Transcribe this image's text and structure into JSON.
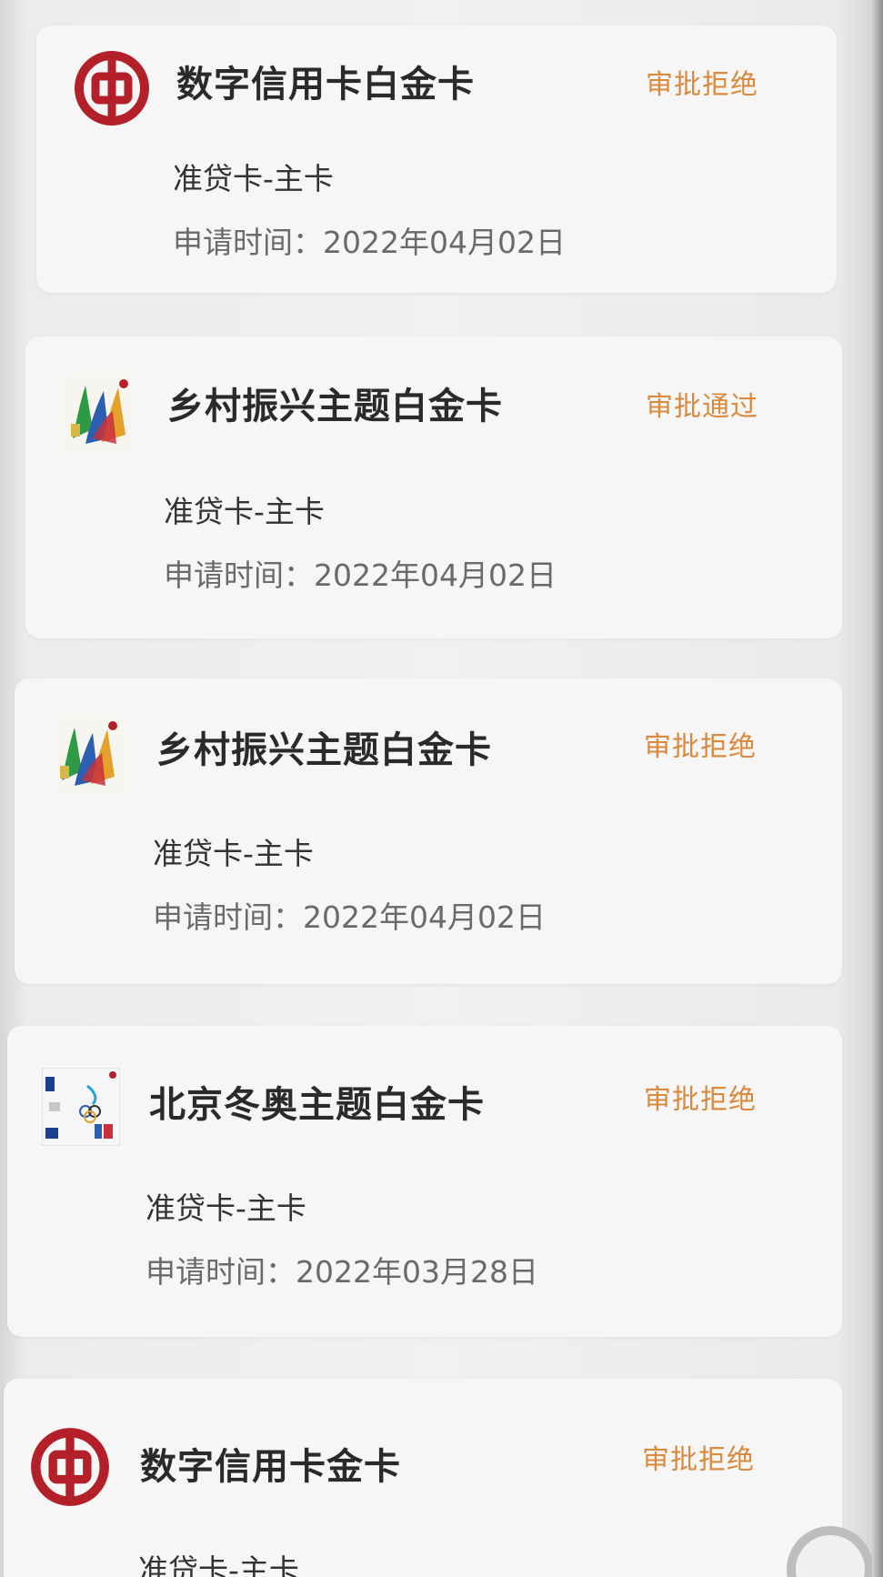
{
  "applications": [
    {
      "title": "数字信用卡白金卡",
      "status": "审批拒绝",
      "type": "准贷卡-主卡",
      "date_label": "申请时间：",
      "date": "2022年04月02日",
      "icon": "boc-logo-icon"
    },
    {
      "title": "乡村振兴主题白金卡",
      "status": "审批通过",
      "type": "准贷卡-主卡",
      "date_label": "申请时间：",
      "date": "2022年04月02日",
      "icon": "rural-card-art-icon"
    },
    {
      "title": "乡村振兴主题白金卡",
      "status": "审批拒绝",
      "type": "准贷卡-主卡",
      "date_label": "申请时间：",
      "date": "2022年04月02日",
      "icon": "rural-card-art-icon"
    },
    {
      "title": "北京冬奥主题白金卡",
      "status": "审批拒绝",
      "type": "准贷卡-主卡",
      "date_label": "申请时间：",
      "date": "2022年03月28日",
      "icon": "olympic-card-art-icon"
    },
    {
      "title": "数字信用卡金卡",
      "status": "审批拒绝",
      "type": "准贷卡-主卡",
      "icon": "boc-logo-icon"
    }
  ],
  "colors": {
    "status": "#d98a3c",
    "boc_red": "#b3202a"
  }
}
